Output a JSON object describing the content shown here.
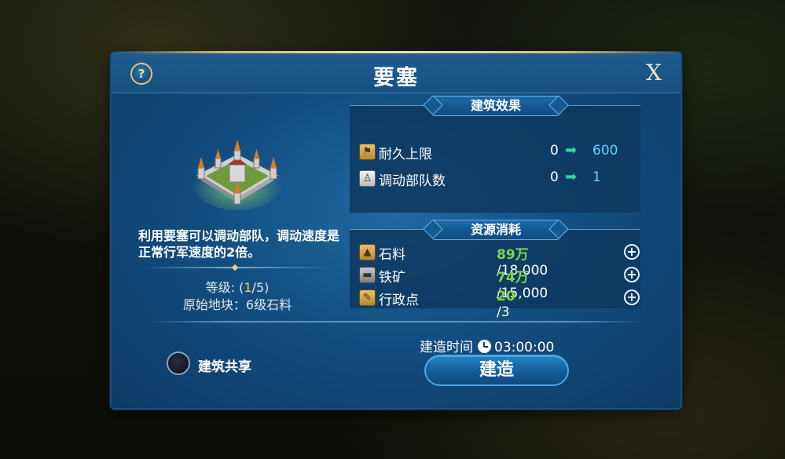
{
  "dialog": {
    "title": "要塞",
    "help_label": "?",
    "close_label": "X"
  },
  "building": {
    "description": "利用要塞可以调动部队，调动速度是正常行军速度的2倍。",
    "level_prefix": "等级: (",
    "level_current": "1",
    "level_suffix": "/5)",
    "origin_tile": "原始地块：6级石料"
  },
  "effects": {
    "header": "建筑效果",
    "rows": [
      {
        "icon": "durability-icon",
        "label": "耐久上限",
        "from": "0",
        "arrow": "➡",
        "to": "600"
      },
      {
        "icon": "troop-icon",
        "label": "调动部队数",
        "from": "0",
        "arrow": "➡",
        "to": "1"
      }
    ]
  },
  "resources": {
    "header": "资源消耗",
    "rows": [
      {
        "icon": "stone-icon",
        "label": "石料",
        "have": "89万",
        "sep": "/",
        "need": "18,000"
      },
      {
        "icon": "iron-icon",
        "label": "铁矿",
        "have": "74万",
        "sep": "/",
        "need": "15,000"
      },
      {
        "icon": "admin-point-icon",
        "label": "行政点",
        "have": "20",
        "sep": "/",
        "need": "3"
      }
    ],
    "plus_label": "+"
  },
  "share": {
    "label": "建筑共享"
  },
  "build": {
    "time_label": "建造时间",
    "time_value": "03:00:00",
    "button_label": "建造"
  },
  "colors": {
    "accent_gold": "#e2c27a",
    "resource_have": "#7fd84a",
    "effect_target": "#5fd7ff",
    "arrow": "#33d6a0"
  }
}
